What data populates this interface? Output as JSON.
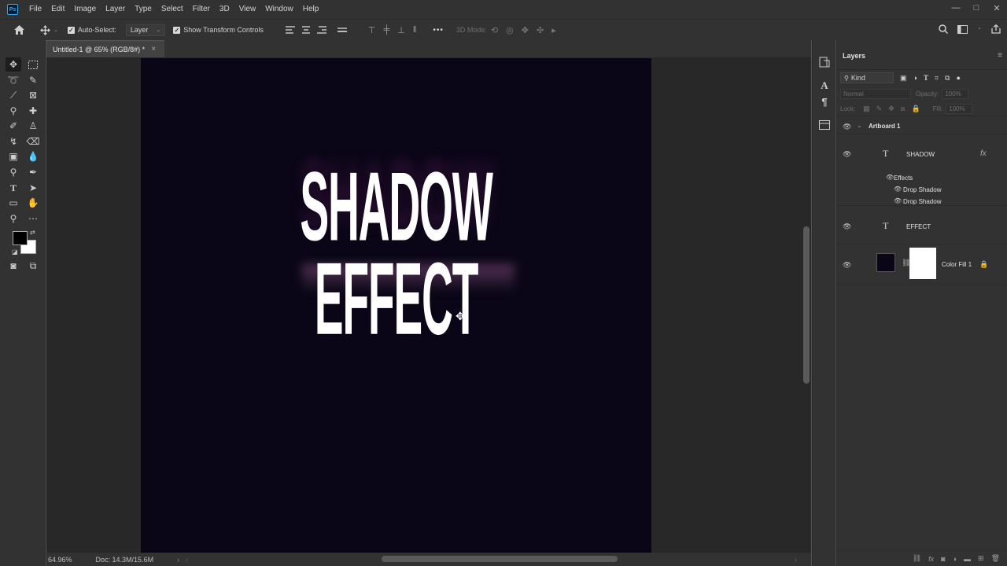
{
  "app": {
    "logo": "Ps"
  },
  "menu": [
    "File",
    "Edit",
    "Image",
    "Layer",
    "Type",
    "Select",
    "Filter",
    "3D",
    "View",
    "Window",
    "Help"
  ],
  "window_controls": {
    "minimize": "—",
    "maximize": "□",
    "close": "✕"
  },
  "options_bar": {
    "auto_select_label": "Auto-Select:",
    "auto_select_checked": true,
    "auto_select_target": "Layer",
    "show_transform_label": "Show Transform Controls",
    "show_transform_checked": true,
    "more_label": "•••",
    "mode_3d_label": "3D Mode:"
  },
  "document": {
    "tab_title": "Untitled-1 @ 65% (RGB/8#) *",
    "tab_close": "×",
    "canvas_color": "#0a0617",
    "text_line1": "SHADOW",
    "text_line2": "EFFECT",
    "zoom": "64.96%",
    "doc_size": "Doc: 14.3M/15.6M"
  },
  "layers_panel": {
    "title": "Layers",
    "filter_kind": "Kind",
    "blend_mode": "Normal",
    "opacity_label": "Opacity:",
    "opacity_value": "100%",
    "lock_label": "Lock:",
    "fill_label": "Fill:",
    "fill_value": "100%",
    "artboard": "Artboard 1",
    "layers": [
      {
        "name": "SHADOW",
        "type": "text",
        "fx": "fx",
        "effects_label": "Effects",
        "effects": [
          "Drop Shadow",
          "Drop Shadow"
        ]
      },
      {
        "name": "EFFECT",
        "type": "text"
      },
      {
        "name": "Color Fill 1",
        "type": "fill",
        "locked": true
      }
    ]
  },
  "colors": {
    "foreground": "#000000",
    "background": "#ffffff",
    "accent": "#31a8ff",
    "ui_bg": "#323232",
    "pasteboard": "#282828"
  }
}
